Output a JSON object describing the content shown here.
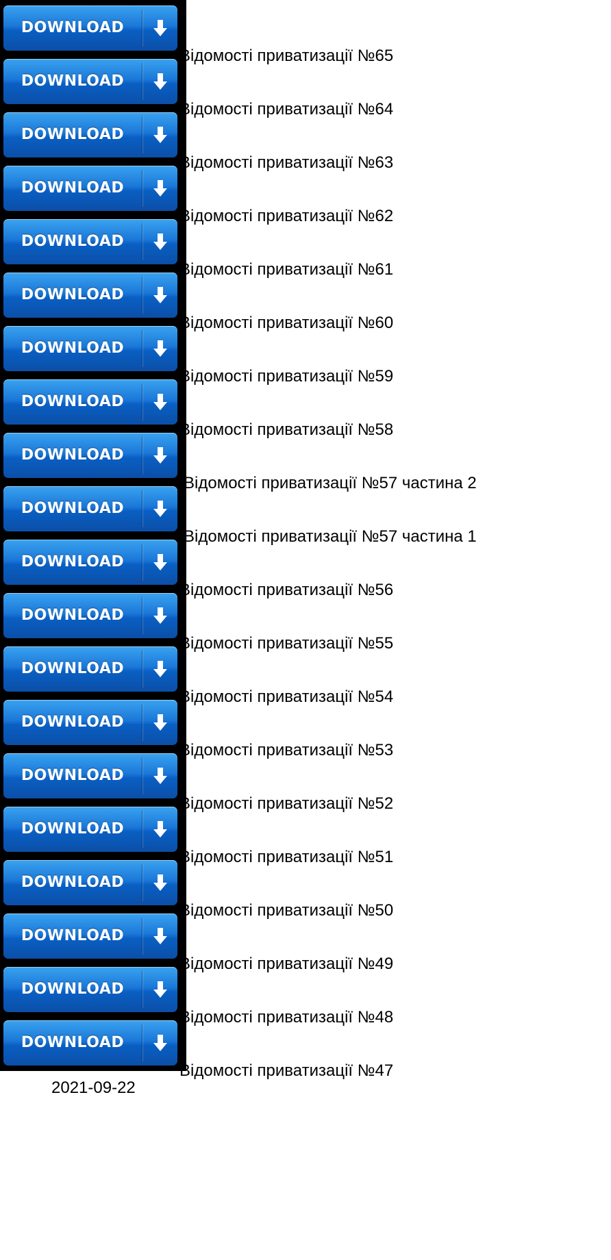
{
  "button_label": "DOWNLOAD",
  "button_icon": "download-arrow-icon",
  "colors": {
    "button_top": "#3aa3f0",
    "button_bottom": "#0b4fa8",
    "button_frame": "#000000",
    "text": "#000000",
    "background": "#ffffff"
  },
  "last_entry_date": "2021-09-22",
  "documents": [
    {
      "title": "Відомості приватизації №65"
    },
    {
      "title": "Відомості приватизації №64"
    },
    {
      "title": "Відомості приватизації №63"
    },
    {
      "title": "Відомості приватизації №62"
    },
    {
      "title": "Відомості приватизації №61"
    },
    {
      "title": "Відомості приватизації №60"
    },
    {
      "title": "Відомості приватизації №59"
    },
    {
      "title": "Відомості приватизації №58"
    },
    {
      "title": "Відомості приватизації №57 частина 2"
    },
    {
      "title": "Відомості приватизації №57 частина 1"
    },
    {
      "title": "Відомості приватизації №56"
    },
    {
      "title": "Відомості приватизації №55"
    },
    {
      "title": "Відомості приватизації №54"
    },
    {
      "title": "Відомості приватизації №53"
    },
    {
      "title": "Відомості приватизації №52"
    },
    {
      "title": "Відомості приватизації №51"
    },
    {
      "title": "Відомості приватизації №50"
    },
    {
      "title": "Відомості приватизації №49"
    },
    {
      "title": "Відомості приватизації №48"
    },
    {
      "title": "Відомості приватизації №47",
      "date": "2021-09-22"
    }
  ]
}
